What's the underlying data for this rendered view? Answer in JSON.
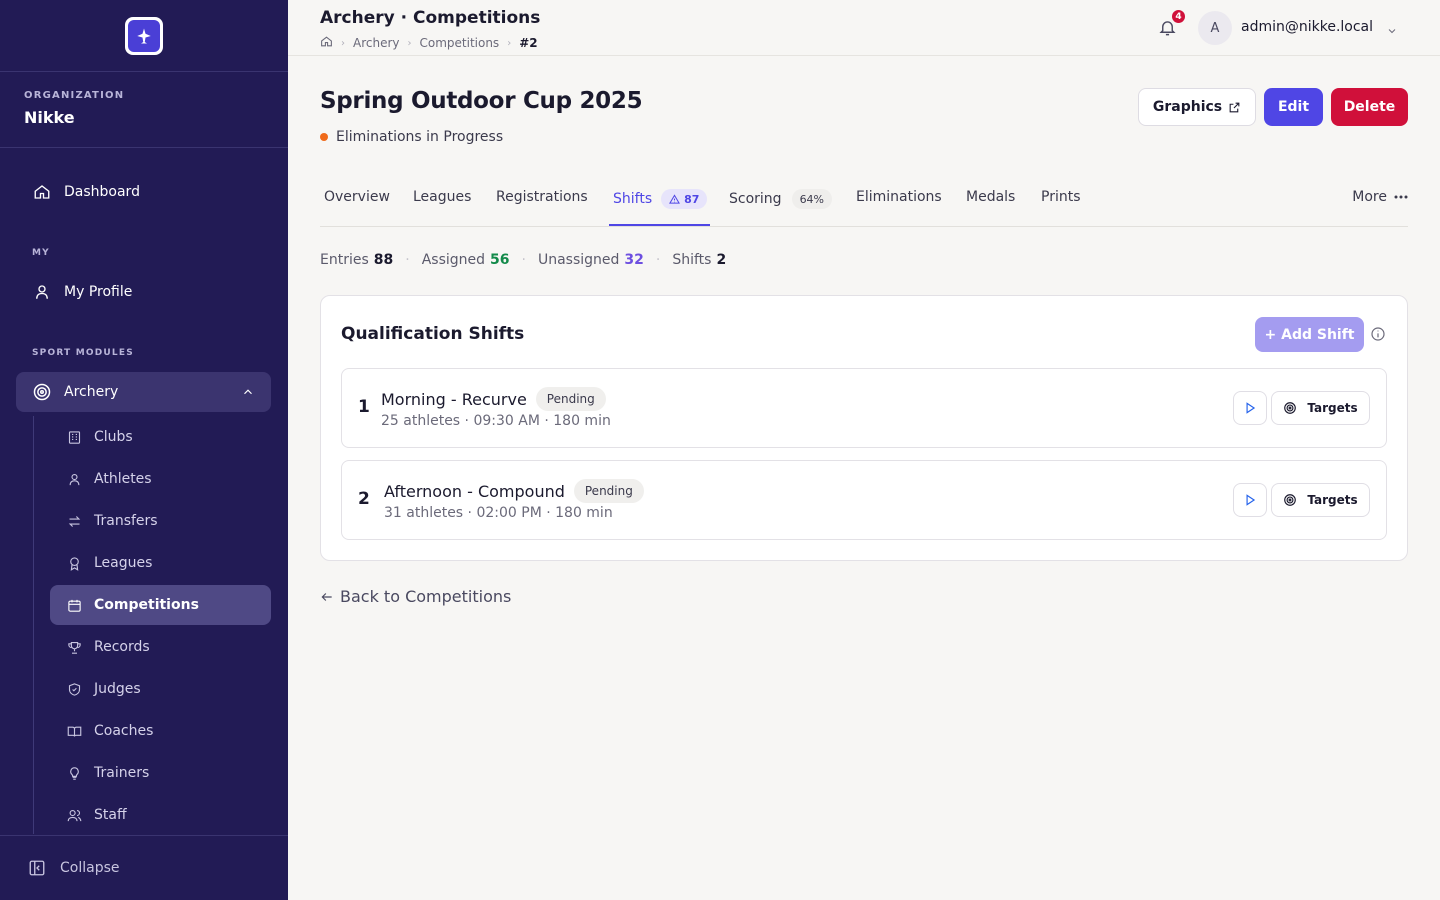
{
  "header": {
    "title": "Archery · Competitions",
    "breadcrumbs": [
      "Archery",
      "Competitions",
      "#2"
    ],
    "notifications_count": "4",
    "avatar_initial": "A",
    "user_email": "admin@nikke.local"
  },
  "sidebar": {
    "org_label": "ORGANIZATION",
    "org_name": "Nikke",
    "dashboard": "Dashboard",
    "my_section": "MY",
    "my_profile": "My Profile",
    "sport_section": "SPORT MODULES",
    "archery": "Archery",
    "sub_items": [
      "Clubs",
      "Athletes",
      "Transfers",
      "Leagues",
      "Competitions",
      "Records",
      "Judges",
      "Coaches",
      "Trainers",
      "Staff"
    ],
    "collapse": "Collapse"
  },
  "competition": {
    "title": "Spring Outdoor Cup 2025",
    "status": "Eliminations in Progress",
    "graphics_label": "Graphics",
    "edit_label": "Edit",
    "delete_label": "Delete"
  },
  "tabs": {
    "overview": "Overview",
    "leagues": "Leagues",
    "registrations": "Registrations",
    "shifts": "Shifts",
    "shifts_badge": "87",
    "scoring": "Scoring",
    "scoring_pct": "64%",
    "eliminations": "Eliminations",
    "medals": "Medals",
    "prints": "Prints",
    "more": "More"
  },
  "stats": {
    "entries_label": "Entries",
    "entries": "88",
    "assigned_label": "Assigned",
    "assigned": "56",
    "unassigned_label": "Unassigned",
    "unassigned": "32",
    "shifts_label": "Shifts",
    "shifts": "2"
  },
  "card": {
    "title": "Qualification Shifts",
    "add_shift": "+ Add Shift",
    "shifts": [
      {
        "number": "1",
        "name": "Morning - Recurve",
        "status": "Pending",
        "meta": "25 athletes · 09:30 AM · 180 min",
        "targets": "Targets"
      },
      {
        "number": "2",
        "name": "Afternoon - Compound",
        "status": "Pending",
        "meta": "31 athletes · 02:00 PM · 180 min",
        "targets": "Targets"
      }
    ]
  },
  "back_link": "Back to Competitions",
  "colors": {
    "sidebar_bg": "#221b55",
    "accent": "#4f46e5",
    "danger": "#d0103a",
    "status_dot": "#f06a1a"
  }
}
